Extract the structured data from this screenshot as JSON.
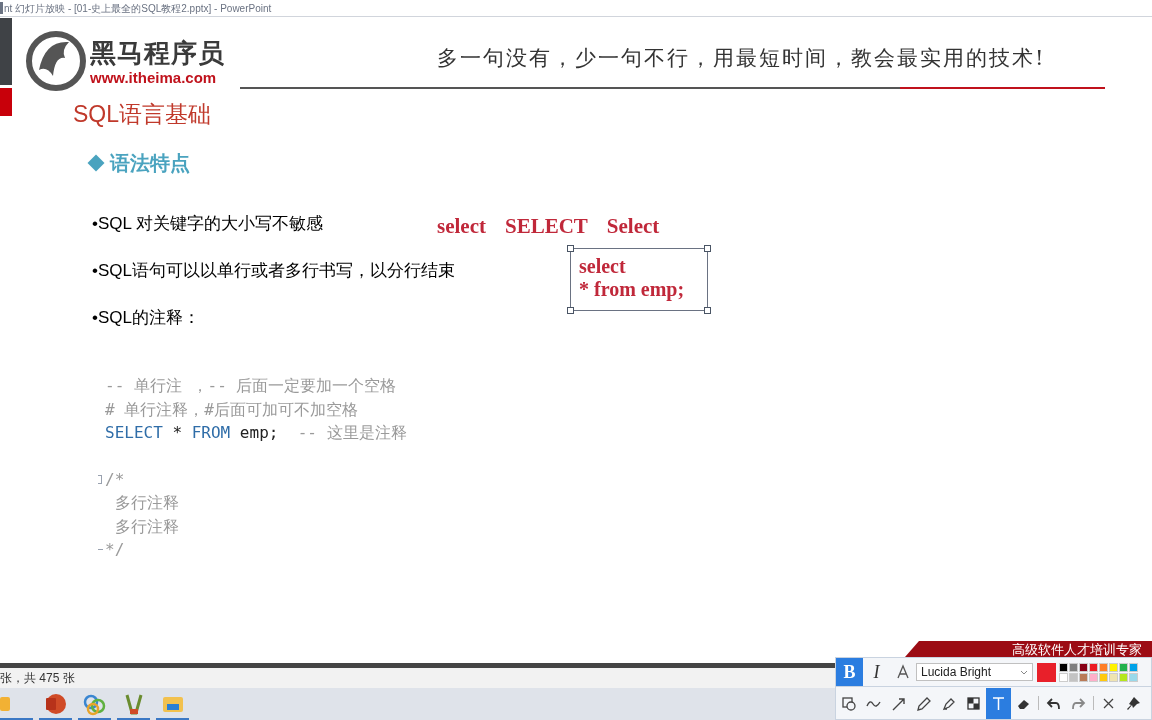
{
  "window": {
    "title": "nt 幻灯片放映 - [01-史上最全的SQL教程2.pptx] - PowerPoint"
  },
  "slide": {
    "brand": "黑马程序员",
    "url": "www.itheima.com",
    "slogan": "多一句没有，少一句不行，用最短时间，教会最实用的技术!",
    "title": "SQL语言基础",
    "section": "语法特点",
    "bullets": [
      "•SQL 对关键字的大小写不敏感",
      "•SQL语句可以以单行或者多行书写，以分行结束",
      "•SQL的注释："
    ],
    "keyword_examples": [
      "select",
      "SELECT",
      "Select"
    ],
    "textbox": {
      "lines": [
        "select",
        "* from emp;"
      ],
      "selected": true
    },
    "code": [
      {
        "kind": "line",
        "segments": [
          {
            "kind": "comment",
            "text": "-- 单行注 ，-- 后面一定要加一个空格"
          }
        ]
      },
      {
        "kind": "line",
        "segments": [
          {
            "kind": "comment",
            "text": "# 单行注释，#后面可加可不加空格"
          }
        ]
      },
      {
        "kind": "line",
        "segments": [
          {
            "kind": "keyword",
            "text": "SELECT"
          },
          {
            "kind": "plain",
            "text": " * "
          },
          {
            "kind": "keyword",
            "text": "FROM"
          },
          {
            "kind": "plain",
            "text": " emp;  "
          },
          {
            "kind": "comment",
            "text": "-- 这里是注释"
          }
        ]
      },
      {
        "kind": "fold_start",
        "gap_before": true,
        "segments": [
          {
            "kind": "comment",
            "text": "/*"
          }
        ]
      },
      {
        "kind": "line",
        "segments": [
          {
            "kind": "comment",
            "text": " 多行注释"
          }
        ]
      },
      {
        "kind": "line",
        "segments": [
          {
            "kind": "comment",
            "text": " 多行注释"
          }
        ]
      },
      {
        "kind": "fold_end",
        "segments": [
          {
            "kind": "comment",
            "text": "*/"
          }
        ]
      }
    ],
    "banner": "高级软件人才培训专家"
  },
  "status_bar": "张，共 475 张",
  "taskbar": [
    {
      "kind": "folder"
    },
    {
      "kind": "powerpoint"
    },
    {
      "kind": "rings"
    },
    {
      "kind": "brush"
    },
    {
      "kind": "explorer"
    }
  ],
  "pen_toolbar": {
    "format_buttons": [
      {
        "label": "B",
        "selected": true
      },
      {
        "label": "I",
        "selected": false
      }
    ],
    "font": "Lucida Bright",
    "current": {
      "color": "#e8202a"
    },
    "palette": [
      {
        "color": "#000000"
      },
      {
        "color": "#7f7f7f"
      },
      {
        "color": "#880015"
      },
      {
        "color": "#ed1c24"
      },
      {
        "color": "#ff7f27"
      },
      {
        "color": "#fff200"
      },
      {
        "color": "#22b14c"
      },
      {
        "color": "#00a2e8"
      },
      {
        "color": "#ffffff"
      },
      {
        "color": "#c3c3c3"
      },
      {
        "color": "#b97a57"
      },
      {
        "color": "#ffaec9"
      },
      {
        "color": "#ffc90e"
      },
      {
        "color": "#efe4b0"
      },
      {
        "color": "#b5e61d"
      },
      {
        "color": "#99d9ea"
      }
    ],
    "tools": [
      {
        "kind": "shape",
        "selected": false
      },
      {
        "kind": "squiggle",
        "selected": false
      },
      {
        "kind": "arrow",
        "selected": false
      },
      {
        "kind": "pencil",
        "selected": false
      },
      {
        "kind": "highlighter",
        "selected": false
      },
      {
        "kind": "mosaic",
        "selected": false
      },
      {
        "kind": "text",
        "selected": true
      },
      {
        "kind": "eraser",
        "selected": false
      },
      {
        "kind": "sep"
      },
      {
        "kind": "undo",
        "selected": false
      },
      {
        "kind": "redo",
        "selected": false
      },
      {
        "kind": "sep"
      },
      {
        "kind": "close",
        "selected": false
      },
      {
        "kind": "pin",
        "selected": false
      }
    ]
  }
}
